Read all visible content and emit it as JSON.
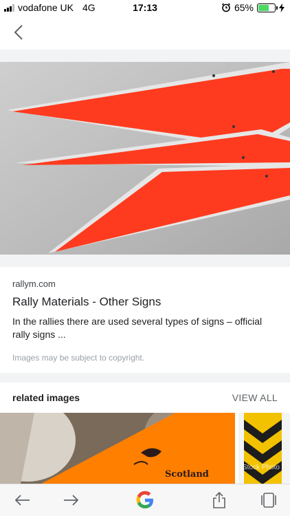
{
  "status_bar": {
    "carrier": "vodafone UK",
    "network": "4G",
    "time": "17:13",
    "battery_percent": "65%",
    "battery_level": 0.65
  },
  "nav": {
    "back_icon": "chevron-left-icon"
  },
  "result": {
    "source": "rallym.com",
    "title": "Rally Materials - Other Signs",
    "snippet": "In the rallies there are used several types of signs – official rally signs ...",
    "copyright_note": "Images may be subject to copyright."
  },
  "related": {
    "label": "related images",
    "view_all": "VIEW ALL",
    "thumb1_text": "Scotland",
    "thumb2_watermark": "Stock Photo"
  },
  "toolbar": {
    "back_icon": "arrow-left-icon",
    "forward_icon": "arrow-right-icon",
    "google_icon": "google-g-icon",
    "share_icon": "share-icon",
    "tabs_icon": "tabs-icon"
  },
  "colors": {
    "sign_orange": "#ff3b1f",
    "google_blue": "#4285f4",
    "google_red": "#ea4335",
    "google_yellow": "#fbbc05",
    "google_green": "#34a853",
    "battery_green": "#4cd964"
  }
}
